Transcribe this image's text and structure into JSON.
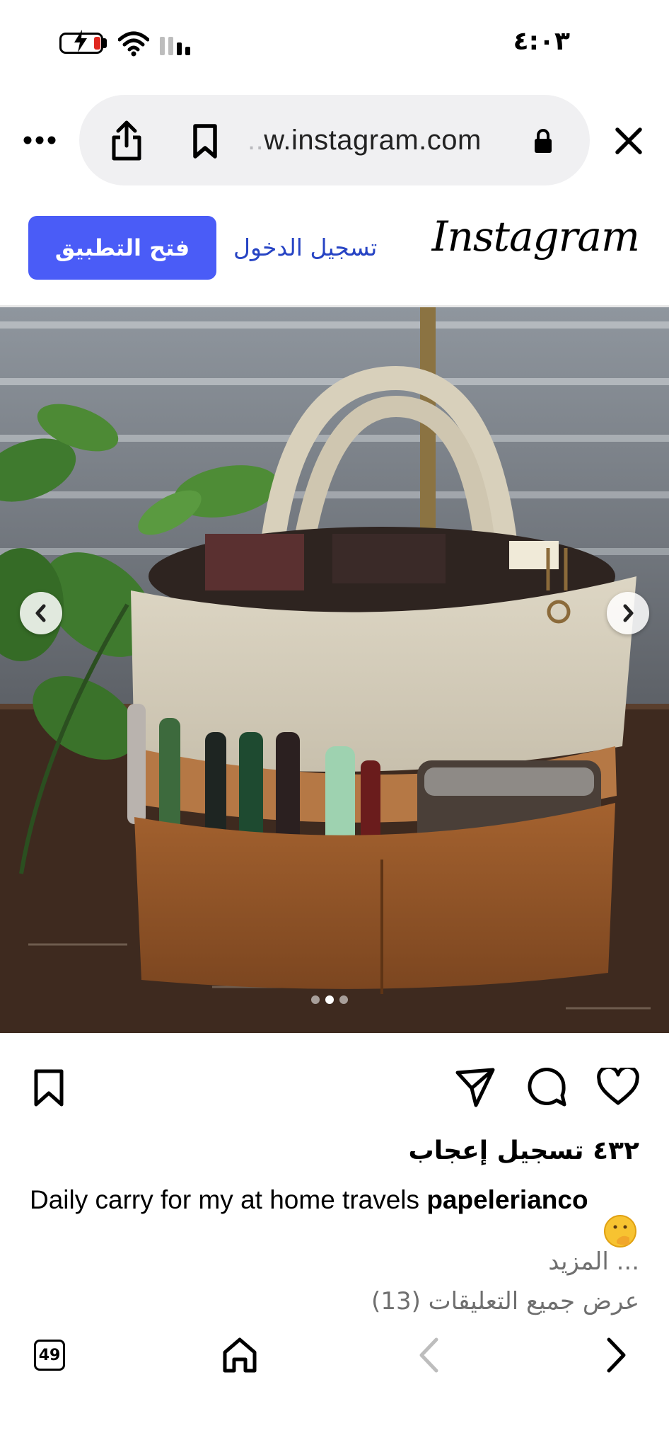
{
  "status_bar": {
    "time": "٤:٠٣",
    "battery_state": "charging-low",
    "colors": {
      "battery_low": "#e0271f"
    }
  },
  "browser": {
    "url_prefix": "..",
    "url": "w.instagram.com",
    "menu_icon": "more-dots-icon",
    "share_icon": "share-icon",
    "bookmark_icon": "bookmark-icon",
    "lock_icon": "lock-icon",
    "close_icon": "close-icon"
  },
  "header": {
    "logo": "Instagram",
    "login_label": "تسجيل الدخول",
    "open_app_label": "فتح التطبيق",
    "colors": {
      "accent": "#4a5cf7",
      "link": "#2744c4"
    }
  },
  "post": {
    "image_alt": "Canvas and leather tote bag holding fountain pens and notebooks next to a plant",
    "carousel": {
      "count": 3,
      "active_index": 1
    },
    "likes_text": "٤٣٢ تسجيل إعجاب",
    "username": "papelerianco",
    "caption": "Daily carry for my at home travels",
    "more_label": "المزيد ...",
    "view_comments_label": "عرض جميع التعليقات (13)"
  },
  "toolbar": {
    "tab_count": "49"
  }
}
